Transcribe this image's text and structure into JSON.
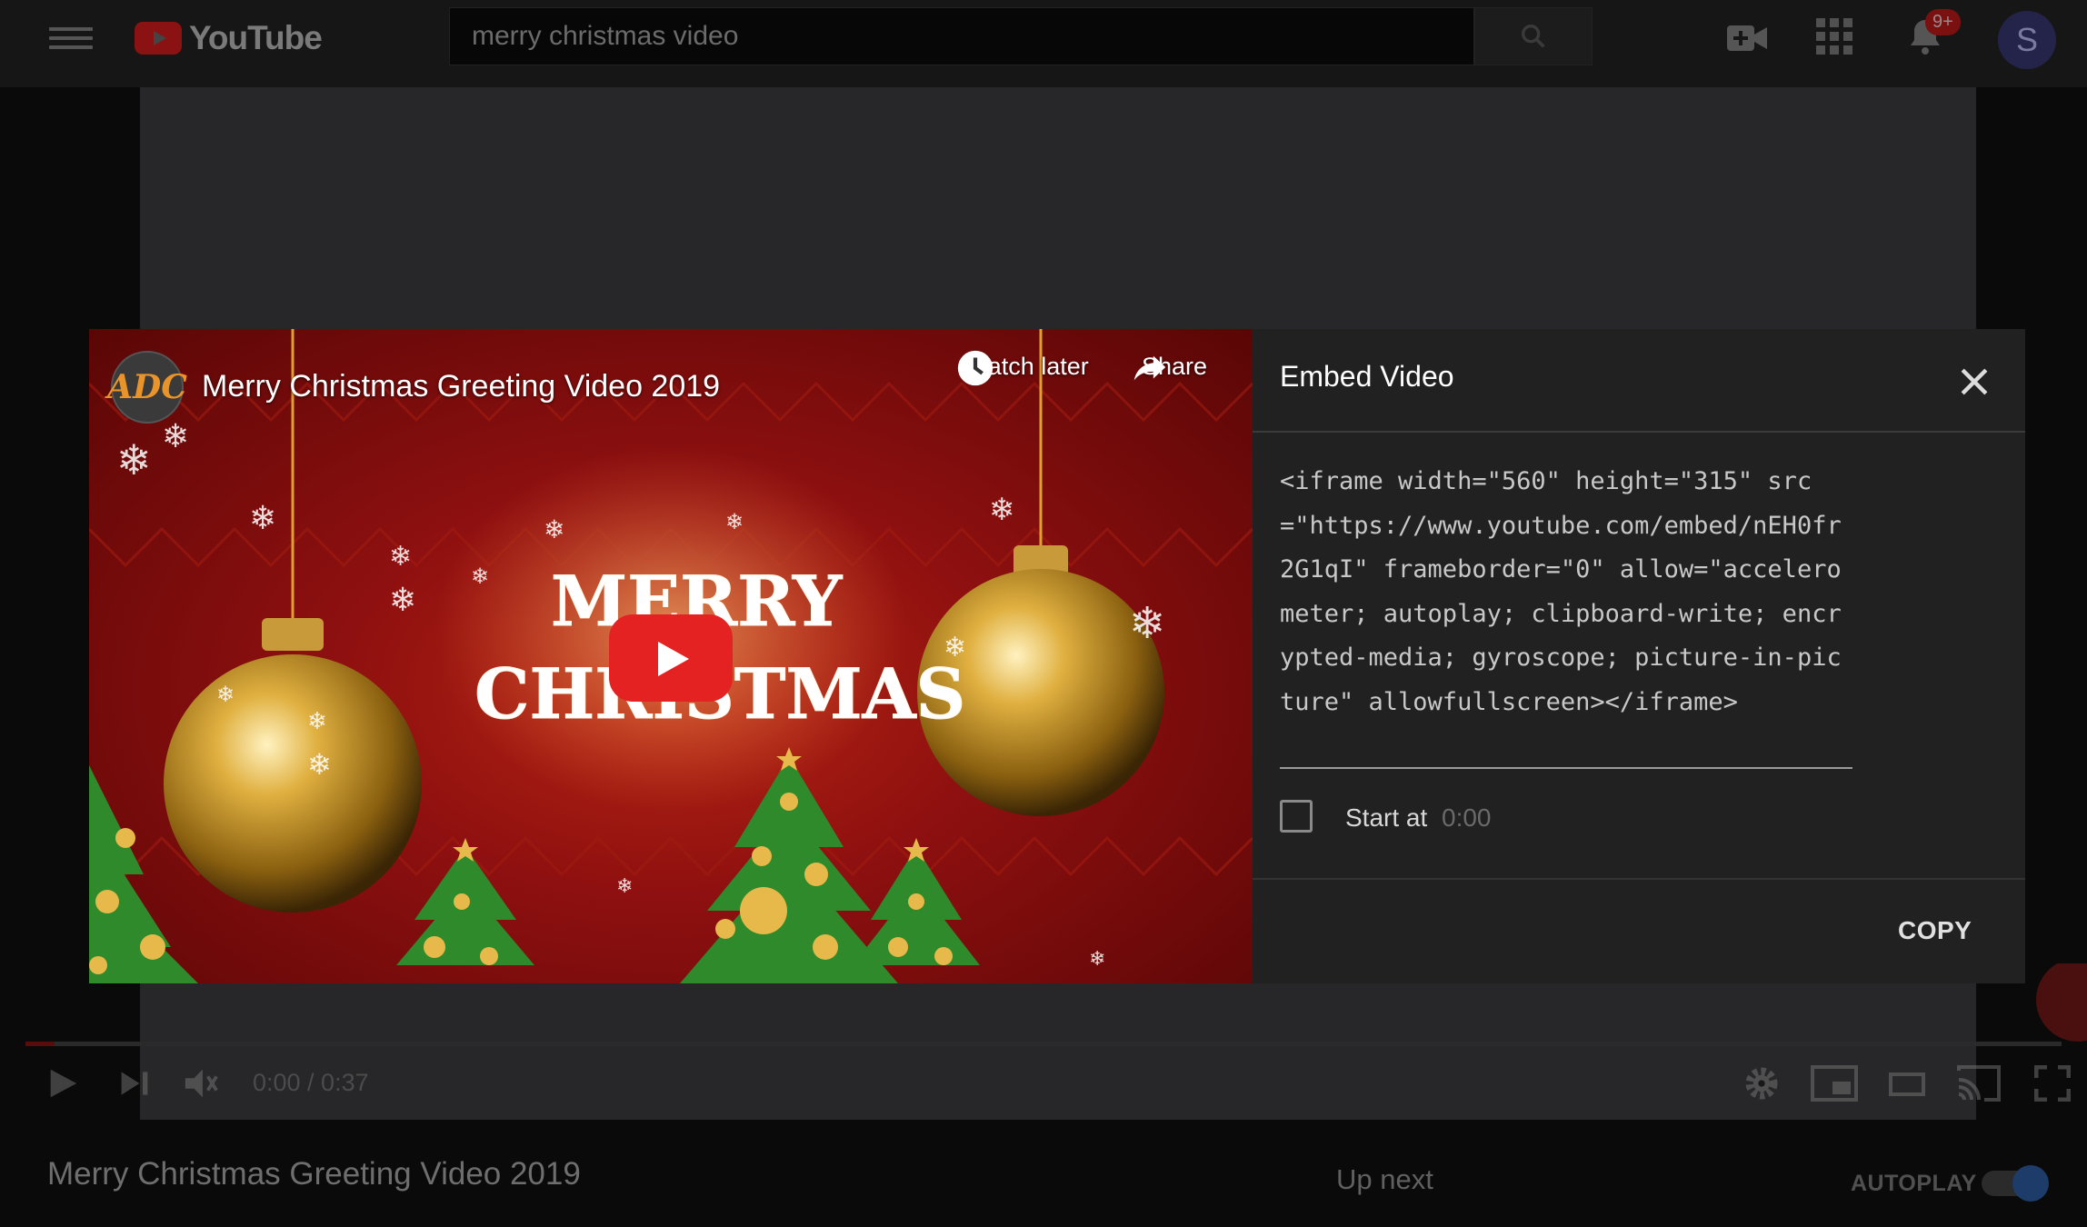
{
  "topbar": {
    "logo_text": "YouTube",
    "search_query": "merry christmas video",
    "notification_count": "9+",
    "avatar_letter": "S"
  },
  "player": {
    "time": "0:00 / 0:37"
  },
  "watch": {
    "title": "Merry Christmas Greeting Video 2019",
    "up_next": "Up next",
    "autoplay": "AUTOPLAY"
  },
  "embed_dialog": {
    "title": "Embed Video",
    "code": "<iframe width=\"560\" height=\"315\" src=\"https://www.youtube.com/embed/nEH0fr2G1qI\" frameborder=\"0\" allow=\"accelerometer; autoplay; clipboard-write; encrypted-media; gyroscope; picture-in-picture\" allowfullscreen></iframe>",
    "start_at_label": "Start at",
    "start_at_value": "0:00",
    "start_at_checked": false,
    "copy_label": "COPY"
  },
  "video_preview": {
    "channel_logo_text": "ADC",
    "title": "Merry Christmas Greeting Video 2019",
    "watch_later_label": "Watch later",
    "share_label": "Share",
    "headline_line1": "MERRY",
    "headline_line2": "CHRISTMAS"
  },
  "colors": {
    "accent_red": "#e52222",
    "panel_bg": "#212121",
    "autoplay_blue": "#1e3c6a"
  }
}
